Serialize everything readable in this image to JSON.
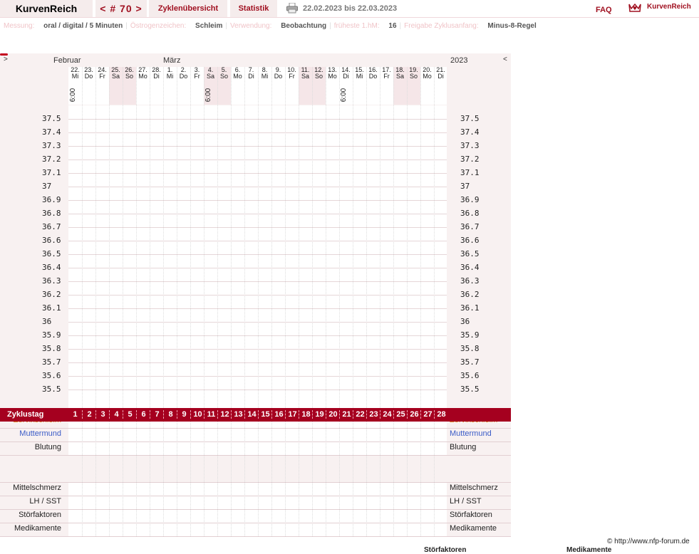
{
  "header": {
    "brand": "KurvenReich",
    "cycle_nav": "< # 70 >",
    "tabs": [
      "Zyklenübersicht",
      "Statistik"
    ],
    "print_icon": "printer-icon",
    "date_range": "22.02.2023 bis 22.03.2023",
    "faq": "FAQ",
    "logo_text": "KurvenReich",
    "logo_icon": "crown-heart-icon"
  },
  "info": [
    {
      "label": "Messung:",
      "value": "oral / digital / 5 Minuten"
    },
    {
      "label": "Östrogenzeichen:",
      "value": "Schleim"
    },
    {
      "label": "Verwendung:",
      "value": "Beobachtung"
    },
    {
      "label": "früheste 1.hM:",
      "value": "16"
    },
    {
      "label": "Freigabe Zyklusanfang:",
      "value": "Minus-8-Regel"
    }
  ],
  "chart": {
    "nav_prev": ">",
    "nav_next": "<",
    "month1": "Februar",
    "month2": "März",
    "year": "2023",
    "days": [
      {
        "d": "22.",
        "w": "Mi",
        "t": "6:00",
        "we": false
      },
      {
        "d": "23.",
        "w": "Do",
        "t": "",
        "we": false
      },
      {
        "d": "24.",
        "w": "Fr",
        "t": "",
        "we": false
      },
      {
        "d": "25.",
        "w": "Sa",
        "t": "",
        "we": true
      },
      {
        "d": "26.",
        "w": "So",
        "t": "",
        "we": true
      },
      {
        "d": "27.",
        "w": "Mo",
        "t": "",
        "we": false
      },
      {
        "d": "28.",
        "w": "Di",
        "t": "",
        "we": false
      },
      {
        "d": "1.",
        "w": "Mi",
        "t": "",
        "we": false
      },
      {
        "d": "2.",
        "w": "Do",
        "t": "",
        "we": false
      },
      {
        "d": "3.",
        "w": "Fr",
        "t": "",
        "we": false
      },
      {
        "d": "4.",
        "w": "Sa",
        "t": "6:00",
        "we": true
      },
      {
        "d": "5.",
        "w": "So",
        "t": "",
        "we": true
      },
      {
        "d": "6.",
        "w": "Mo",
        "t": "",
        "we": false
      },
      {
        "d": "7.",
        "w": "Di",
        "t": "",
        "we": false
      },
      {
        "d": "8.",
        "w": "Mi",
        "t": "",
        "we": false
      },
      {
        "d": "9.",
        "w": "Do",
        "t": "",
        "we": false
      },
      {
        "d": "10.",
        "w": "Fr",
        "t": "",
        "we": false
      },
      {
        "d": "11.",
        "w": "Sa",
        "t": "",
        "we": true
      },
      {
        "d": "12.",
        "w": "So",
        "t": "",
        "we": true
      },
      {
        "d": "13.",
        "w": "Mo",
        "t": "",
        "we": false
      },
      {
        "d": "14.",
        "w": "Di",
        "t": "6:00",
        "we": false
      },
      {
        "d": "15.",
        "w": "Mi",
        "t": "",
        "we": false
      },
      {
        "d": "16.",
        "w": "Do",
        "t": "",
        "we": false
      },
      {
        "d": "17.",
        "w": "Fr",
        "t": "",
        "we": false
      },
      {
        "d": "18.",
        "w": "Sa",
        "t": "",
        "we": true
      },
      {
        "d": "19.",
        "w": "So",
        "t": "",
        "we": true
      },
      {
        "d": "20.",
        "w": "Mo",
        "t": "",
        "we": false
      },
      {
        "d": "21.",
        "w": "Di",
        "t": "",
        "we": false
      }
    ],
    "temps": [
      "37.5",
      "37.4",
      "37.3",
      "37.2",
      "37.1",
      "37",
      "36.9",
      "36.8",
      "36.7",
      "36.6",
      "36.5",
      "36.4",
      "36.3",
      "36.2",
      "36.1",
      "36",
      "35.9",
      "35.8",
      "35.7",
      "35.6",
      "35.5"
    ],
    "rows_upper": [
      {
        "label": "Zervixschleim",
        "color": "#e08a1e"
      },
      {
        "label": "Muttermund",
        "color": "#3a5bc7"
      },
      {
        "label": "Blutung",
        "color": "#222222"
      }
    ],
    "bleeding_marker_day": 1,
    "cycle_label": "Zyklustag",
    "cycle_days": [
      "1",
      "2",
      "3",
      "4",
      "5",
      "6",
      "7",
      "8",
      "9",
      "10",
      "11",
      "12",
      "13",
      "14",
      "15",
      "16",
      "17",
      "18",
      "19",
      "20",
      "21",
      "22",
      "23",
      "24",
      "25",
      "26",
      "27",
      "28"
    ],
    "rows_lower": [
      {
        "label": "Mittelschmerz"
      },
      {
        "label": "LH / SST"
      },
      {
        "label": "Störfaktoren"
      },
      {
        "label": "Medikamente"
      }
    ]
  },
  "footer": {
    "copyright": "© http://www.nfp-forum.de",
    "legend1": "Störfaktoren",
    "legend2": "Medikamente"
  },
  "colors": {
    "accent": "#a5001f",
    "panel": "#f8f1f1",
    "weekend": "#f5e6e8"
  }
}
